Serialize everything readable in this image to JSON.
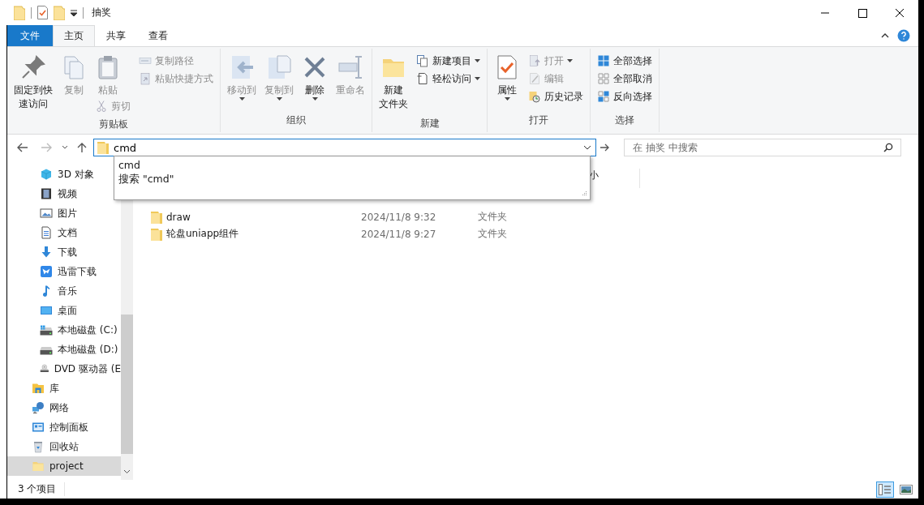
{
  "window": {
    "title": "抽奖"
  },
  "ribbon": {
    "file_tab": "文件",
    "tabs": [
      {
        "label": "主页",
        "selected": true
      },
      {
        "label": "共享",
        "selected": false
      },
      {
        "label": "查看",
        "selected": false
      }
    ],
    "groups": [
      {
        "label": "剪贴板",
        "columns": [
          {
            "kind": "large",
            "items": [
              {
                "label": [
                  "固定到快",
                  "速访问"
                ],
                "disabled": false,
                "dropdown": false
              }
            ]
          },
          {
            "kind": "large",
            "items": [
              {
                "label": "复制",
                "disabled": true,
                "dropdown": false
              }
            ]
          },
          {
            "kind": "paste",
            "items": [
              {
                "label": "粘贴",
                "disabled": true,
                "dropdown": false
              },
              {
                "label": "剪切",
                "disabled": true,
                "dropdown": false
              }
            ]
          },
          {
            "kind": "stack",
            "items": [
              {
                "label": "复制路径",
                "disabled": true,
                "dropdown": false
              },
              {
                "label": "粘贴快捷方式",
                "disabled": true,
                "dropdown": false
              }
            ]
          }
        ]
      },
      {
        "label": "组织",
        "columns": [
          {
            "kind": "large",
            "items": [
              {
                "label": "移动到",
                "disabled": true,
                "dropdown": true
              }
            ]
          },
          {
            "kind": "large",
            "items": [
              {
                "label": "复制到",
                "disabled": true,
                "dropdown": true
              }
            ]
          },
          {
            "kind": "large",
            "items": [
              {
                "label": "删除",
                "disabled": false,
                "dropdown": true
              }
            ]
          },
          {
            "kind": "large",
            "items": [
              {
                "label": "重命名",
                "disabled": true,
                "dropdown": false
              }
            ]
          }
        ]
      },
      {
        "label": "新建",
        "columns": [
          {
            "kind": "large",
            "items": [
              {
                "label": [
                  "新建",
                  "文件夹"
                ],
                "disabled": false,
                "dropdown": false
              }
            ]
          },
          {
            "kind": "stack",
            "items": [
              {
                "label": "新建项目",
                "disabled": false,
                "dropdown": true
              },
              {
                "label": "轻松访问",
                "disabled": false,
                "dropdown": true
              }
            ]
          }
        ]
      },
      {
        "label": "打开",
        "columns": [
          {
            "kind": "large",
            "items": [
              {
                "label": "属性",
                "disabled": false,
                "dropdown": true
              }
            ]
          },
          {
            "kind": "stack",
            "items": [
              {
                "label": "打开",
                "disabled": true,
                "dropdown": true
              },
              {
                "label": "编辑",
                "disabled": true,
                "dropdown": false
              },
              {
                "label": "历史记录",
                "disabled": false,
                "dropdown": false
              }
            ]
          }
        ]
      },
      {
        "label": "选择",
        "columns": [
          {
            "kind": "stack",
            "items": [
              {
                "label": "全部选择",
                "disabled": false,
                "dropdown": false
              },
              {
                "label": "全部取消",
                "disabled": false,
                "dropdown": false
              },
              {
                "label": "反向选择",
                "disabled": false,
                "dropdown": false
              }
            ]
          }
        ]
      }
    ]
  },
  "address_bar": {
    "value": "cmd",
    "suggestions": [
      "cmd",
      "搜索 \"cmd\""
    ]
  },
  "search": {
    "placeholder": "在 抽奖 中搜索"
  },
  "navigation": {
    "pc_items": [
      {
        "label": "3D 对象",
        "selected": false
      },
      {
        "label": "视频",
        "selected": false
      },
      {
        "label": "图片",
        "selected": false
      },
      {
        "label": "文档",
        "selected": false
      },
      {
        "label": "下载",
        "selected": false
      },
      {
        "label": "迅雷下载",
        "selected": false
      },
      {
        "label": "音乐",
        "selected": false
      },
      {
        "label": "桌面",
        "selected": false
      },
      {
        "label": "本地磁盘 (C:)",
        "selected": false
      },
      {
        "label": "本地磁盘 (D:)",
        "selected": false
      },
      {
        "label": "DVD 驱动器 (E",
        "selected": false
      }
    ],
    "items": [
      {
        "label": "库",
        "selected": false
      },
      {
        "label": "网络",
        "selected": false
      },
      {
        "label": "控制面板",
        "selected": false
      },
      {
        "label": "回收站",
        "selected": false
      },
      {
        "label": "project",
        "selected": true
      }
    ]
  },
  "file_list": {
    "columns": [
      {
        "label": "小"
      }
    ],
    "rows": [
      {
        "name": "draw",
        "modified": "2024/11/8 9:32",
        "type": "文件夹"
      },
      {
        "name": "轮盘uniapp组件",
        "modified": "2024/11/8 9:27",
        "type": "文件夹"
      }
    ]
  },
  "status_bar": {
    "item_count": "3 个项目",
    "views": [
      {
        "selected": true
      },
      {
        "selected": false
      }
    ]
  }
}
